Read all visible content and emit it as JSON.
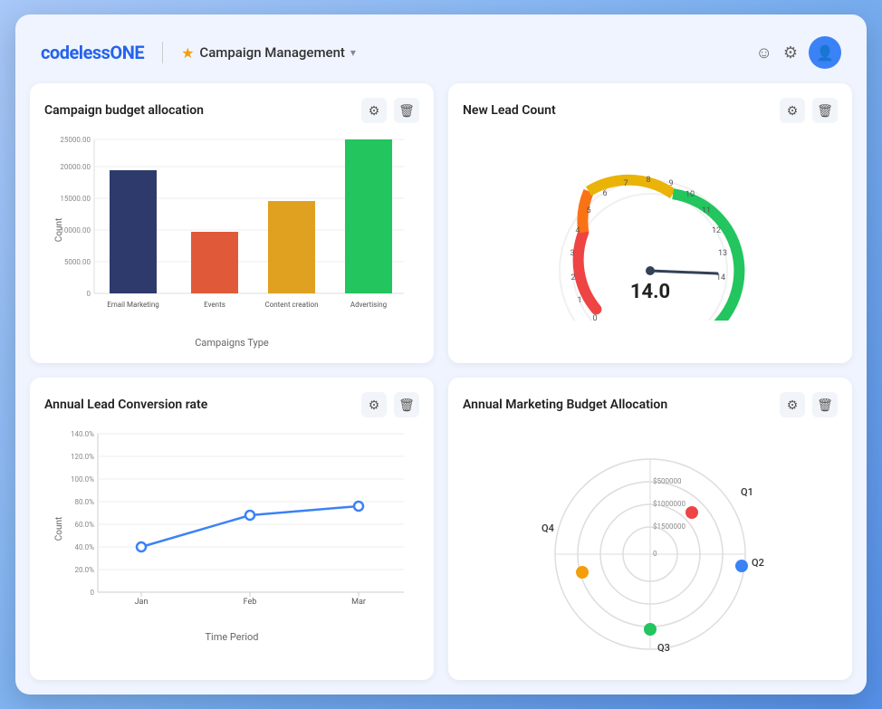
{
  "header": {
    "logo_text": "codeless",
    "logo_accent": "ONE",
    "nav_title": "Campaign Management",
    "nav_chevron": "▾",
    "avatar_icon": "👤"
  },
  "cards": {
    "budget_allocation": {
      "title": "Campaign budget allocation",
      "x_label": "Campaigns Type",
      "y_label": "Count",
      "bars": [
        {
          "label": "Email Marketing",
          "value": 20000,
          "color": "#2d3a6b"
        },
        {
          "label": "Events",
          "value": 10000,
          "color": "#e05a3a"
        },
        {
          "label": "Content creation",
          "value": 15000,
          "color": "#e0a020"
        },
        {
          "label": "Advertising",
          "value": 25000,
          "color": "#22c55e"
        }
      ],
      "y_ticks": [
        "0",
        "5000.00",
        "10000.00",
        "15000.00",
        "20000.00",
        "25000.00"
      ]
    },
    "new_lead_count": {
      "title": "New Lead Count",
      "value": "14.0",
      "gauge_min": 0,
      "gauge_max": 14
    },
    "lead_conversion": {
      "title": "Annual Lead Conversion rate",
      "x_label": "Time Period",
      "y_label": "Count",
      "points": [
        {
          "label": "Jan",
          "value": 40
        },
        {
          "label": "Feb",
          "value": 68
        },
        {
          "label": "Mar",
          "value": 80
        }
      ],
      "y_ticks": [
        "0",
        "20.0%",
        "40.0%",
        "60.0%",
        "80.0%",
        "100.0%",
        "120.0%",
        "140.0%"
      ]
    },
    "marketing_budget": {
      "title": "Annual Marketing Budget Allocation",
      "labels": [
        "Q1",
        "Q2",
        "Q3",
        "Q4"
      ],
      "ring_labels": [
        "$1500000",
        "$1000000",
        "$500000",
        "0"
      ],
      "dot_colors": [
        "#ef4444",
        "#3b82f6",
        "#22c55e",
        "#f59e0b"
      ]
    }
  }
}
